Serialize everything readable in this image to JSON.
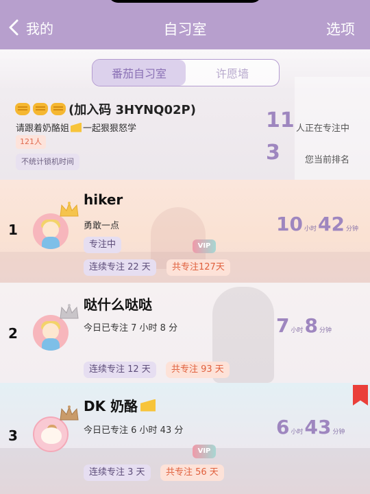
{
  "nav": {
    "back_label": "我的",
    "title": "自习室",
    "options_label": "选项"
  },
  "tabs": [
    {
      "label": "番茄自习室",
      "active": true
    },
    {
      "label": "许愿墙",
      "active": false
    }
  ],
  "room": {
    "name_prefix": "",
    "name": "(加入码 3HYNQ02P)",
    "desc_before": "请跟着奶酪姐",
    "desc_after": "一起狠狠怒学",
    "members_badge": "121人",
    "lock_badge": "不统计锁机时间"
  },
  "stats": {
    "focusing_count": "11",
    "focusing_label": "人正在专注中",
    "rank_value": "3",
    "rank_label": "您当前排名"
  },
  "leaderboard": [
    {
      "rank": "1",
      "name": "hiker",
      "subtitle": "勇敢一点",
      "status": "专注中",
      "vip": "VIP",
      "streak": "连续专注 22 天",
      "total": "共专注127天",
      "hours": "10",
      "minutes": "42"
    },
    {
      "rank": "2",
      "name": "哒什么哒哒",
      "subtitle": "今日已专注 7 小时 8 分",
      "streak": "连续专注 12 天",
      "total": "共专注 93 天",
      "hours": "7",
      "minutes": "8"
    },
    {
      "rank": "3",
      "name": "DK 奶酪",
      "subtitle": "今日已专注 6 小时 43 分",
      "vip": "VIP",
      "streak": "连续专注 3 天",
      "total": "共专注 56 天",
      "hours": "6",
      "minutes": "43"
    }
  ],
  "units": {
    "hour": "小时",
    "minute": "分钟"
  },
  "colors": {
    "nav_bg": "#b79fcd",
    "accent_purple": "#9e86bf",
    "orange": "#e0603d",
    "bookmark": "#ea3f3a"
  },
  "icons": {
    "back": "chevron-left-icon",
    "fist": "fist-emoji-icon",
    "cheese": "cheese-emoji-icon",
    "crown_gold": "gold-crown-icon",
    "crown_silver": "silver-crown-icon",
    "crown_bronze": "bronze-crown-icon",
    "bookmark": "bookmark-icon"
  }
}
